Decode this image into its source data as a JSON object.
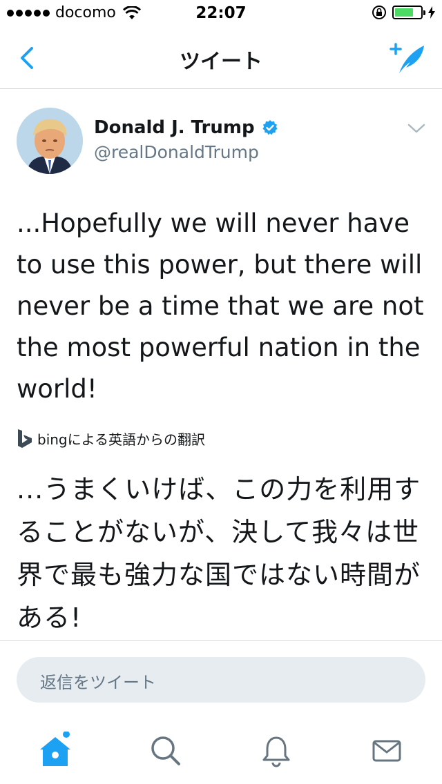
{
  "status_bar": {
    "carrier": "docomo",
    "time": "22:07",
    "battery_level": 0.7,
    "icons": [
      "signal-dots-icon",
      "wifi-icon",
      "rotation-lock-icon",
      "battery-icon",
      "charging-bolt-icon"
    ]
  },
  "nav": {
    "title": "ツイート",
    "back_icon": "chevron-left-icon",
    "compose_icon": "compose-tweet-icon"
  },
  "tweet": {
    "author_name": "Donald J. Trump",
    "author_handle": "@realDonaldTrump",
    "verified": true,
    "text": "...Hopefully we will never have to use this power, but there will never be a time that we are not the most powerful nation in the world!",
    "translation_credit": "bingによる英語からの翻訳",
    "translation": "...うまくいけば、この力を利用することがないが、決して我々は世界で最も強力な国ではない時間がある!"
  },
  "reply": {
    "placeholder": "返信をツイート"
  },
  "tabs": [
    {
      "name": "home",
      "icon": "home-icon",
      "active": true,
      "notification_dot": true
    },
    {
      "name": "search",
      "icon": "search-icon",
      "active": false
    },
    {
      "name": "notifications",
      "icon": "bell-icon",
      "active": false
    },
    {
      "name": "messages",
      "icon": "envelope-icon",
      "active": false
    }
  ],
  "colors": {
    "accent": "#1da1f2",
    "text": "#14171a",
    "secondary_text": "#657786",
    "icon_gray": "#66757f",
    "reply_box": "#e6ecf0",
    "battery_green": "#4cd964"
  }
}
